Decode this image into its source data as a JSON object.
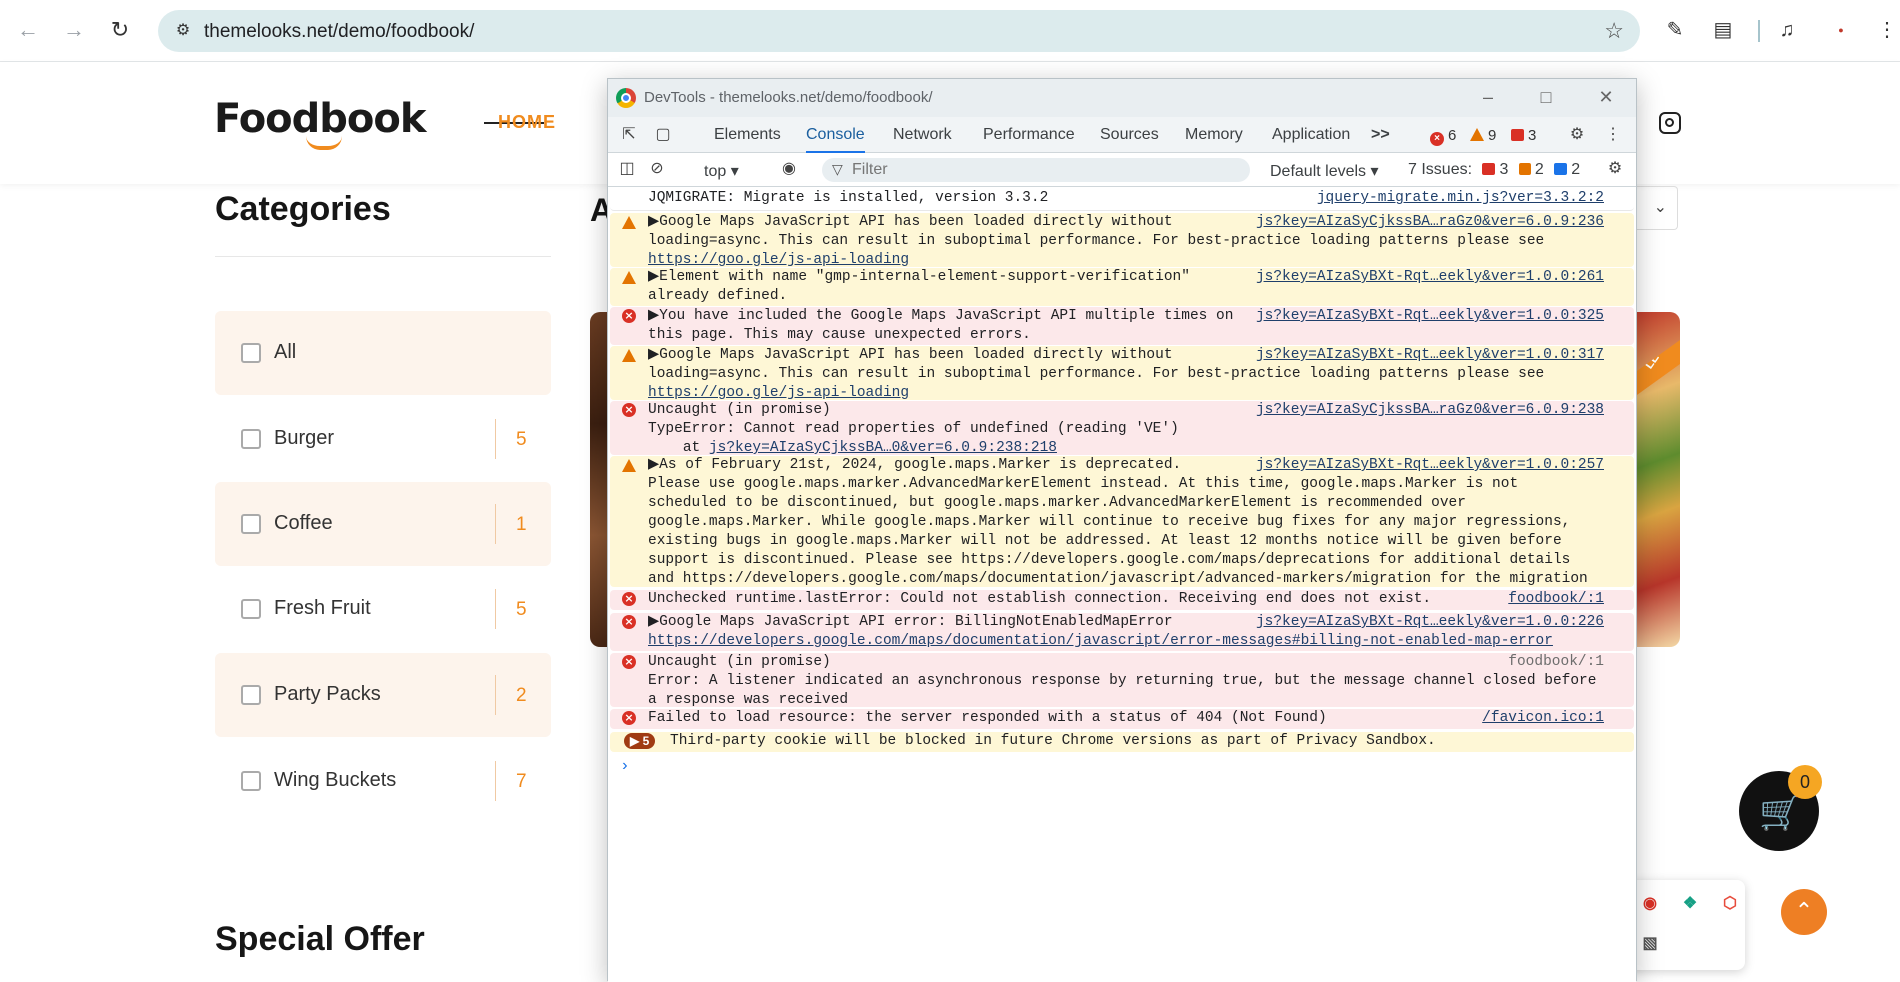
{
  "browser": {
    "url": "themelooks.net/demo/foodbook/",
    "back_icon": "arrow-left-icon",
    "forward_icon": "arrow-right-icon",
    "reload_icon": "reload-icon"
  },
  "site": {
    "logo_text": "Foodbook",
    "nav_home": "HOME",
    "categories_title": "Categories",
    "categories": [
      {
        "label": "All",
        "count": ""
      },
      {
        "label": "Burger",
        "count": "5"
      },
      {
        "label": "Coffee",
        "count": "1"
      },
      {
        "label": "Fresh Fruit",
        "count": "5"
      },
      {
        "label": "Party Packs",
        "count": "2"
      },
      {
        "label": "Wing Buckets",
        "count": "7"
      }
    ],
    "special_offer_title": "Special Offer",
    "peek_heading_letter": "A",
    "sale_ribbon": "LE",
    "cart_count": "0",
    "accent_color": "#f08b1e"
  },
  "devtools": {
    "window_title": "DevTools - themelooks.net/demo/foodbook/",
    "tabs": [
      "Elements",
      "Console",
      "Network",
      "Performance",
      "Sources",
      "Memory",
      "Application"
    ],
    "active_tab": "Console",
    "more_tabs": ">>",
    "error_count": "6",
    "warning_count": "9",
    "issue_count": "3",
    "context": "top",
    "filter_placeholder": "Filter",
    "levels": "Default levels",
    "issues_label": "7 Issues:",
    "issues_error": "3",
    "issues_warn": "2",
    "issues_info": "2",
    "messages": [
      {
        "level": "info",
        "text": "JQMIGRATE: Migrate is installed, version 3.3.2",
        "source": "jquery-migrate.min.js?ver=3.3.2:2"
      },
      {
        "level": "warn",
        "text": "▶Google Maps JavaScript API has been loaded directly without\nloading=async. This can result in suboptimal performance. For best-practice loading patterns please see",
        "link": "https://goo.gle/js-api-loading",
        "source": "js?key=AIzaSyCjkssBA…raGz0&ver=6.0.9:236"
      },
      {
        "level": "warn",
        "text": "▶Element with name \"gmp-internal-element-support-verification\"\nalready defined.",
        "source": "js?key=AIzaSyBXt-Rqt…eekly&ver=1.0.0:261"
      },
      {
        "level": "error",
        "text": "▶You have included the Google Maps JavaScript API multiple times on\nthis page. This may cause unexpected errors.",
        "source": "js?key=AIzaSyBXt-Rqt…eekly&ver=1.0.0:325"
      },
      {
        "level": "warn",
        "text": "▶Google Maps JavaScript API has been loaded directly without\nloading=async. This can result in suboptimal performance. For best-practice loading patterns please see",
        "link": "https://goo.gle/js-api-loading",
        "source": "js?key=AIzaSyBXt-Rqt…eekly&ver=1.0.0:317"
      },
      {
        "level": "error",
        "text": "Uncaught (in promise)\nTypeError: Cannot read properties of undefined (reading 'VE')\n    at ",
        "link": "js?key=AIzaSyCjkssBA…0&ver=6.0.9:238:218",
        "source": "js?key=AIzaSyCjkssBA…raGz0&ver=6.0.9:238"
      },
      {
        "level": "warn",
        "text": "▶As of February 21st, 2024, google.maps.Marker is deprecated.\nPlease use google.maps.marker.AdvancedMarkerElement instead. At this time, google.maps.Marker is not scheduled to be discontinued, but google.maps.marker.AdvancedMarkerElement is recommended over google.maps.Marker. While google.maps.Marker will continue to receive bug fixes for any major regressions, existing bugs in google.maps.Marker will not be addressed. At least 12 months notice will be given before support is discontinued. Please see https://developers.google.com/maps/deprecations for additional details and https://developers.google.com/maps/documentation/javascript/advanced-markers/migration for the migration guide.",
        "source": "js?key=AIzaSyBXt-Rqt…eekly&ver=1.0.0:257"
      },
      {
        "level": "error",
        "text": "Unchecked runtime.lastError: Could not establish connection. Receiving end does not exist.",
        "source": "foodbook/:1"
      },
      {
        "level": "error",
        "text": "▶Google Maps JavaScript API error: BillingNotEnabledMapError",
        "link": "https://developers.google.com/maps/documentation/javascript/error-messages#billing-not-enabled-map-error",
        "source": "js?key=AIzaSyBXt-Rqt…eekly&ver=1.0.0:226"
      },
      {
        "level": "error",
        "text": "Uncaught (in promise)\nError: A listener indicated an asynchronous response by returning true, but the message channel closed before a response was received",
        "source": "foodbook/:1"
      },
      {
        "level": "error",
        "text": "Failed to load resource: the server responded with a status of 404 (Not Found)",
        "source": "/favicon.ico:1"
      }
    ],
    "cookie_badge": "▶ 5",
    "cookie_text": "Third-party cookie will be blocked in future Chrome versions as part of Privacy Sandbox.",
    "prompt": "›"
  }
}
